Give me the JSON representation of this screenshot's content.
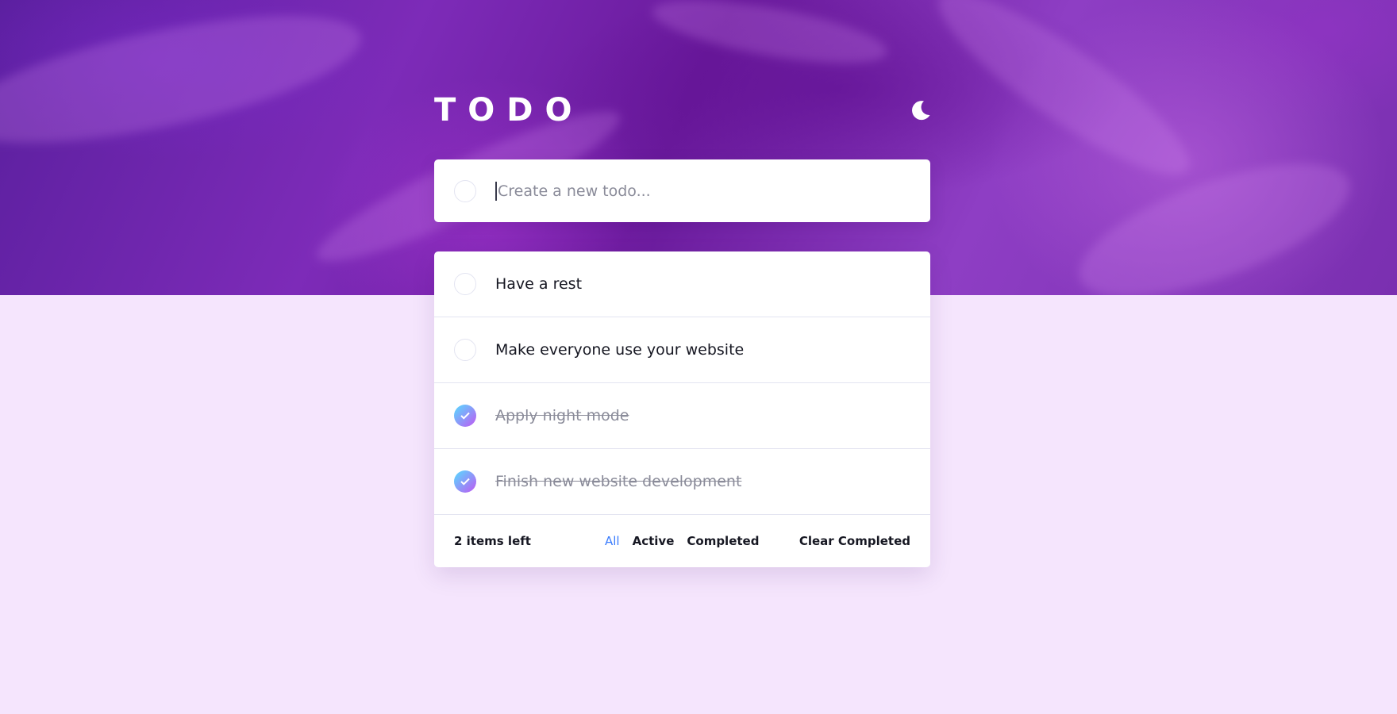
{
  "app": {
    "title": "TODO",
    "theme_toggle_icon": "moon-icon"
  },
  "new_todo": {
    "placeholder": "Create a new todo..."
  },
  "todos": [
    {
      "text": "Have a rest",
      "completed": false
    },
    {
      "text": "Make everyone use your website",
      "completed": false
    },
    {
      "text": "Apply night mode",
      "completed": true
    },
    {
      "text": "Finish new website development",
      "completed": true
    }
  ],
  "footer": {
    "items_left": "2 items left",
    "filters": [
      {
        "label": "All",
        "active": true
      },
      {
        "label": "Active",
        "active": false
      },
      {
        "label": "Completed",
        "active": false
      }
    ],
    "clear_label": "Clear Completed"
  },
  "colors": {
    "accent": "#3a7cfd",
    "check_gradient_start": "#55ddff",
    "check_gradient_end": "#c058f3",
    "page_background": "#f5e5fd"
  }
}
